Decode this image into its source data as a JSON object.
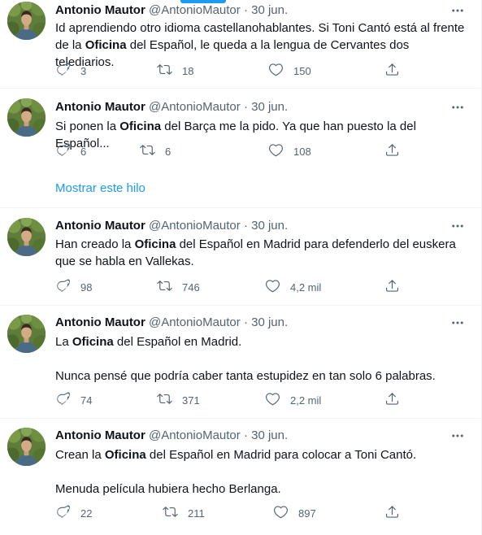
{
  "tweets": [
    {
      "author": "Antonio Mautor",
      "handle": "@AntonioMautor",
      "separator": "·",
      "date": "30 jun.",
      "paragraphs": [
        [
          {
            "t": "Id aprendiendo otro idioma castellanohablantes. Si Toni Cantó está al frente de la "
          },
          {
            "t": "Oficina",
            "b": true
          },
          {
            "t": " del Español, le queda a la lengua de Cervantes dos telediarios."
          }
        ]
      ],
      "replies": "3",
      "retweets": "18",
      "likes": "150"
    },
    {
      "author": "Antonio Mautor",
      "handle": "@AntonioMautor",
      "separator": "·",
      "date": "30 jun.",
      "paragraphs": [
        [
          {
            "t": "Si ponen la "
          },
          {
            "t": "Oficina",
            "b": true
          },
          {
            "t": " del Barça me la pido. Ya que han puesto la del Español..."
          }
        ]
      ],
      "replies": "6",
      "retweets": "6",
      "likes": "108",
      "show_thread": "Mostrar este hilo"
    },
    {
      "author": "Antonio Mautor",
      "handle": "@AntonioMautor",
      "separator": "·",
      "date": "30 jun.",
      "paragraphs": [
        [
          {
            "t": "Han creado la "
          },
          {
            "t": "Oficina",
            "b": true
          },
          {
            "t": " del Español en Madrid para defenderlo del euskera que se habla en Vallekas."
          }
        ]
      ],
      "replies": "98",
      "retweets": "746",
      "likes": "4,2 mil"
    },
    {
      "author": "Antonio Mautor",
      "handle": "@AntonioMautor",
      "separator": "·",
      "date": "30 jun.",
      "paragraphs": [
        [
          {
            "t": "La "
          },
          {
            "t": "Oficina",
            "b": true
          },
          {
            "t": " del Español en Madrid."
          }
        ],
        [
          {
            "t": "Nunca pensé que podría caber tanta estupidez en tan solo 6 palabras."
          }
        ]
      ],
      "replies": "74",
      "retweets": "371",
      "likes": "2,2 mil"
    },
    {
      "author": "Antonio Mautor",
      "handle": "@AntonioMautor",
      "separator": "·",
      "date": "30 jun.",
      "paragraphs": [
        [
          {
            "t": "Crean la "
          },
          {
            "t": "Oficina",
            "b": true
          },
          {
            "t": " del Español en Madrid para colocar a Toni Cantó."
          }
        ],
        [
          {
            "t": "Menuda película hubiera hecho Berlanga."
          }
        ]
      ],
      "replies": "22",
      "retweets": "211",
      "likes": "897"
    }
  ],
  "icons": {
    "reply": "reply-icon",
    "retweet": "retweet-icon",
    "like": "heart-icon",
    "share": "share-icon",
    "more": "more-icon"
  },
  "colors": {
    "accent": "#1d9bf0",
    "secondary_text": "#536471",
    "primary_text": "#0f1419",
    "divider": "#eff3f4"
  }
}
